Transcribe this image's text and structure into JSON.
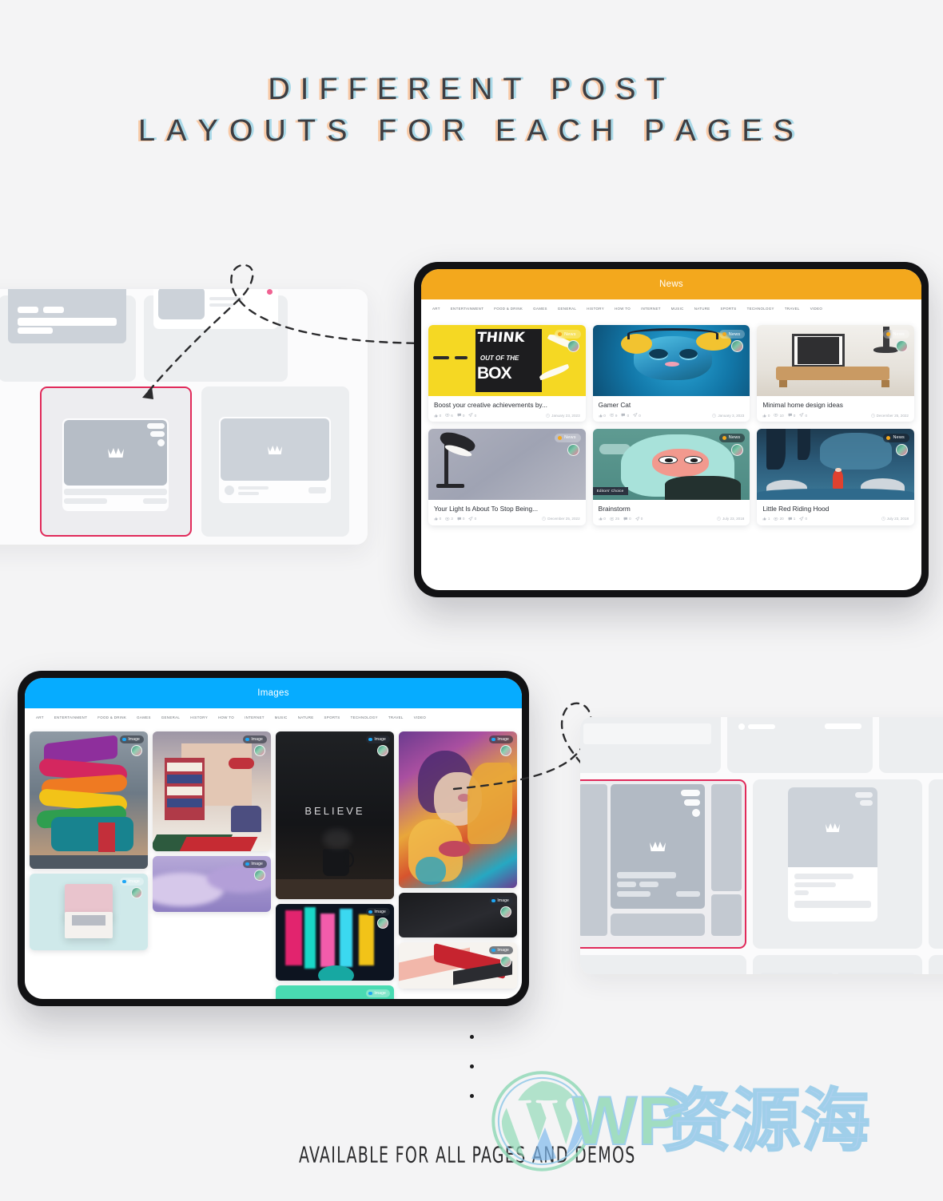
{
  "headline": {
    "line1": "DIFFERENT POST",
    "line2": "LAYOUTS FOR EACH PAGES"
  },
  "footer": {
    "note": "AVAILABLE FOR ALL PAGES AND DEMOS",
    "watermark_latin": "WP",
    "watermark_cn": "资源海"
  },
  "colors": {
    "page_bg": "#f4f4f5",
    "news_accent": "#f3a81d",
    "images_accent": "#06acff",
    "selection_outline": "#e12a5a",
    "headline_text": "#3d3d42",
    "shadow_warm": "#f7c9a6",
    "shadow_cool": "#a9d9e8"
  },
  "nav_categories": [
    "ART",
    "ENTERTAINMENT",
    "FOOD & DRINK",
    "GAMES",
    "GENERAL",
    "HISTORY",
    "HOW TO",
    "INTERNET",
    "MUSIC",
    "NATURE",
    "SPORTS",
    "TECHNOLOGY",
    "TRAVEL",
    "VIDEO"
  ],
  "news_tablet": {
    "site_title": "News",
    "posts": [
      {
        "title": "Boost your creative achievements by...",
        "badge": "News",
        "date": "January 23, 2023",
        "likes": "0",
        "views": "6",
        "comments": "0",
        "shares": "0",
        "editors_choice": null
      },
      {
        "title": "Gamer Cat",
        "badge": "News",
        "date": "January 3, 2023",
        "likes": "0",
        "views": "9",
        "comments": "0",
        "shares": "0",
        "editors_choice": null
      },
      {
        "title": "Minimal home design ideas",
        "badge": "News",
        "date": "December 25, 2022",
        "likes": "0",
        "views": "10",
        "comments": "0",
        "shares": "0",
        "editors_choice": null
      },
      {
        "title": "Your Light Is About To Stop Being...",
        "badge": "News",
        "date": "December 25, 2022",
        "likes": "0",
        "views": "3",
        "comments": "0",
        "shares": "0",
        "editors_choice": null
      },
      {
        "title": "Brainstorm",
        "badge": "News",
        "date": "July 23, 2018",
        "likes": "0",
        "views": "25",
        "comments": "0",
        "shares": "0",
        "editors_choice": "Editors' Choice"
      },
      {
        "title": "Little Red Riding Hood",
        "badge": "News",
        "date": "July 23, 2018",
        "likes": "1",
        "views": "20",
        "comments": "1",
        "shares": "0",
        "editors_choice": null
      }
    ]
  },
  "images_tablet": {
    "site_title": "Images",
    "cards": [
      {
        "badge": "Image",
        "alt": "rainbow spiral building"
      },
      {
        "badge": "Image",
        "alt": "purple clouds"
      },
      {
        "badge": "Image",
        "alt": "pink book on mint background"
      },
      {
        "badge": "Image",
        "alt": "pastel interior with shelf and chair"
      },
      {
        "badge": "Image",
        "alt": "BELIEVE coffee cup poster"
      },
      {
        "badge": "Image",
        "alt": "neon glitch lights"
      },
      {
        "badge": "Image",
        "alt": "pink cassette tape on mint"
      },
      {
        "badge": "Image",
        "alt": "colorful abstract face portrait"
      },
      {
        "badge": "Image",
        "alt": "dark abstract"
      },
      {
        "badge": "Image",
        "alt": "red and white abstract shapes"
      }
    ],
    "believe_text": "BELIEVE"
  },
  "wireframes": {
    "top_left": {
      "selected_cell_label": "selected-layout"
    },
    "bottom_right": {
      "selected_cell_label": "selected-layout"
    }
  }
}
